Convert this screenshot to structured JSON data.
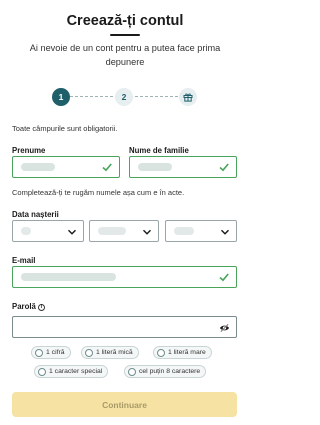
{
  "header": {
    "title": "Creează-ți contul",
    "subtitle": "Ai nevoie de un cont pentru a putea face prima depunere"
  },
  "steps": [
    {
      "label": "1",
      "active": true
    },
    {
      "label": "2",
      "active": false
    },
    {
      "icon": "gift-icon",
      "active": false
    }
  ],
  "form": {
    "required_note": "Toate câmpurile sunt obligatorii.",
    "first_name": {
      "label": "Prenume",
      "value": "",
      "valid": true
    },
    "last_name": {
      "label": "Nume de familie",
      "value": "",
      "valid": true
    },
    "name_hint": "Completează-ți te rugăm numele așa cum e în acte.",
    "birth_date": {
      "label": "Data nașterii",
      "day": "",
      "month": "",
      "year": ""
    },
    "email": {
      "label": "E-mail",
      "value": "",
      "valid": true
    },
    "password": {
      "label": "Parolă",
      "value": "",
      "info_icon": "info-icon",
      "toggle_icon": "eye-off-icon"
    },
    "password_rules": [
      "1 cifră",
      "1 literă mică",
      "1 literă mare",
      "1 caracter special",
      "cel puțin 8 caractere"
    ]
  },
  "cta": {
    "label": "Continuare",
    "enabled": false
  },
  "colors": {
    "primary": "#1e5f6a",
    "valid": "#4ba45c",
    "cta_disabled": "#f6e3a3"
  }
}
